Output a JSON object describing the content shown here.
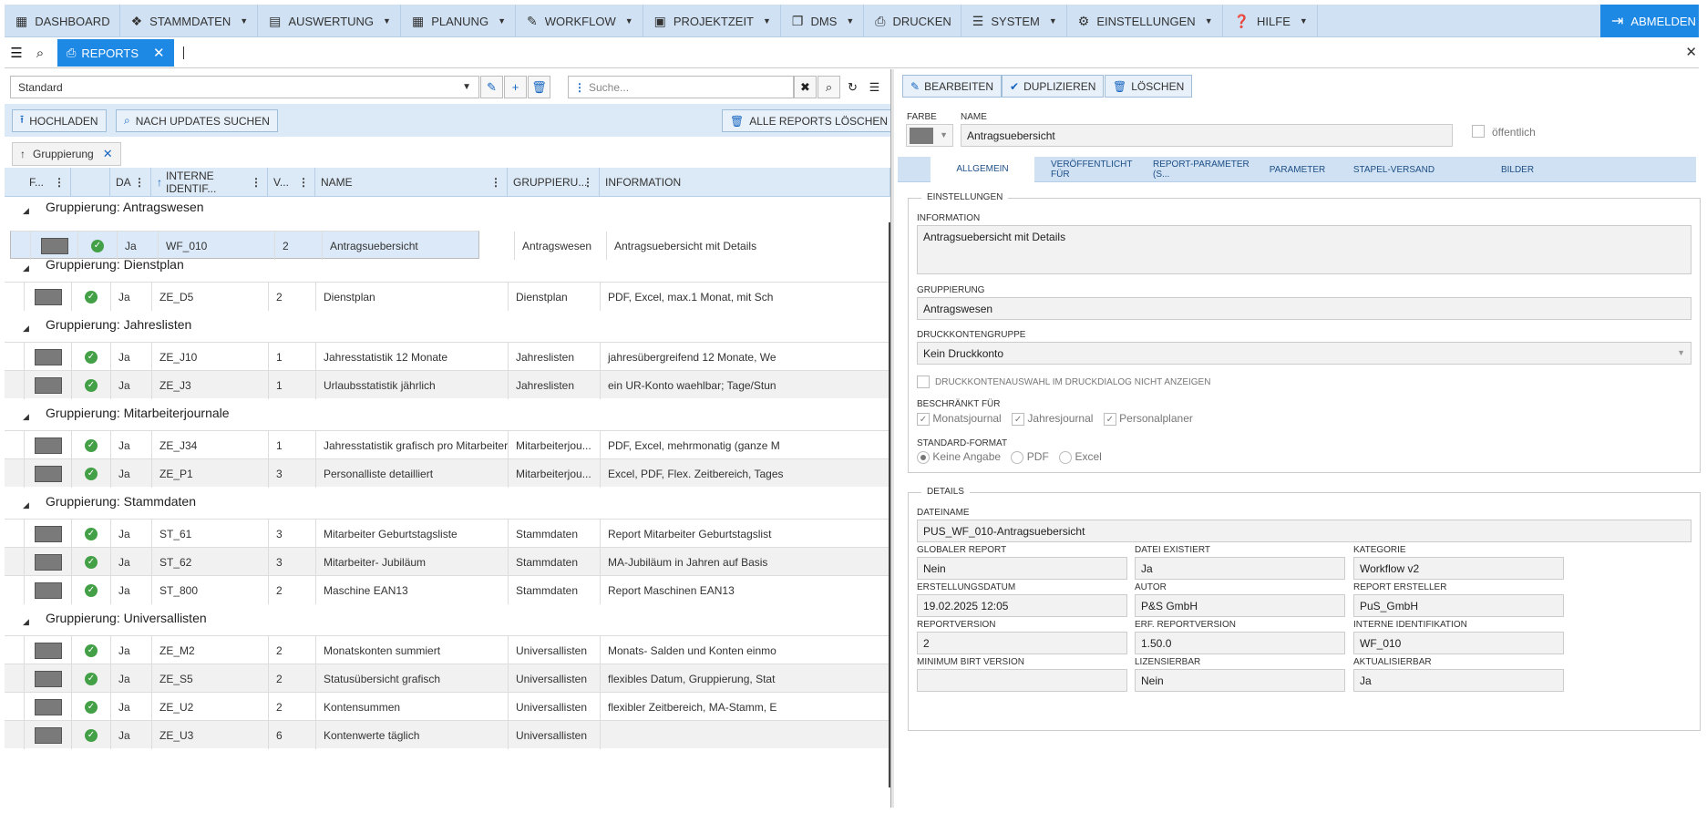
{
  "nav": {
    "items": [
      {
        "label": "DASHBOARD",
        "icon": "dashboard-icon",
        "caret": false
      },
      {
        "label": "STAMMDATEN",
        "icon": "cubes-icon",
        "caret": true
      },
      {
        "label": "AUSWERTUNG",
        "icon": "calendar-chart-icon",
        "caret": true
      },
      {
        "label": "PLANUNG",
        "icon": "calendar-icon",
        "caret": true
      },
      {
        "label": "WORKFLOW",
        "icon": "pencil-icon",
        "caret": true
      },
      {
        "label": "PROJEKTZEIT",
        "icon": "briefcase-icon",
        "caret": true
      },
      {
        "label": "DMS",
        "icon": "copy-icon",
        "caret": true
      },
      {
        "label": "DRUCKEN",
        "icon": "print-icon",
        "caret": false
      },
      {
        "label": "SYSTEM",
        "icon": "server-icon",
        "caret": true
      },
      {
        "label": "EINSTELLUNGEN",
        "icon": "gear-icon",
        "caret": true
      },
      {
        "label": "HILFE",
        "icon": "help-icon",
        "caret": true
      }
    ],
    "logout": "ABMELDEN"
  },
  "tabbar": {
    "tab": "REPORTS"
  },
  "left": {
    "select_value": "Standard",
    "search_placeholder": "Suche...",
    "upload": "HOCHLADEN",
    "updates": "NACH UPDATES SUCHEN",
    "delete_all": "ALLE REPORTS LÖSCHEN",
    "chip": "Gruppierung",
    "columns": [
      "F...",
      "DA",
      "INTERNE IDENTIF...",
      "V...",
      "NAME",
      "GRUPPIERU...",
      "INFORMATION"
    ],
    "groups": [
      {
        "label": "Gruppierung: Antragswesen",
        "rows": [
          {
            "da": "Ja",
            "id": "WF_010",
            "v": "2",
            "name": "Antragsuebersicht",
            "grp": "Antragswesen",
            "info": "Antragsuebersicht mit Details",
            "selected": true
          }
        ]
      },
      {
        "label": "Gruppierung: Dienstplan",
        "rows": [
          {
            "da": "Ja",
            "id": "ZE_D5",
            "v": "2",
            "name": "Dienstplan",
            "grp": "Dienstplan",
            "info": "PDF, Excel, max.1 Monat, mit Sch"
          }
        ]
      },
      {
        "label": "Gruppierung: Jahreslisten",
        "rows": [
          {
            "da": "Ja",
            "id": "ZE_J10",
            "v": "1",
            "name": "Jahresstatistik 12 Monate",
            "grp": "Jahreslisten",
            "info": "jahresübergreifend 12 Monate, We"
          },
          {
            "da": "Ja",
            "id": "ZE_J3",
            "v": "1",
            "name": "Urlaubsstatistik jährlich",
            "grp": "Jahreslisten",
            "info": "ein UR-Konto waehlbar; Tage/Stun"
          }
        ]
      },
      {
        "label": "Gruppierung: Mitarbeiterjournale",
        "rows": [
          {
            "da": "Ja",
            "id": "ZE_J34",
            "v": "1",
            "name": "Jahresstatistik grafisch pro Mitarbeiter",
            "grp": "Mitarbeiterjou...",
            "info": "PDF, Excel, mehrmonatig (ganze M"
          },
          {
            "da": "Ja",
            "id": "ZE_P1",
            "v": "3",
            "name": "Personalliste detailliert",
            "grp": "Mitarbeiterjou...",
            "info": "Excel, PDF, Flex. Zeitbereich, Tages"
          }
        ]
      },
      {
        "label": "Gruppierung: Stammdaten",
        "rows": [
          {
            "da": "Ja",
            "id": "ST_61",
            "v": "3",
            "name": "Mitarbeiter Geburtstagsliste",
            "grp": "Stammdaten",
            "info": "Report Mitarbeiter Geburtstagslist"
          },
          {
            "da": "Ja",
            "id": "ST_62",
            "v": "3",
            "name": "Mitarbeiter- Jubiläum",
            "grp": "Stammdaten",
            "info": "MA-Jubiläum in Jahren auf Basis"
          },
          {
            "da": "Ja",
            "id": "ST_800",
            "v": "2",
            "name": "Maschine EAN13",
            "grp": "Stammdaten",
            "info": "Report Maschinen EAN13"
          }
        ]
      },
      {
        "label": "Gruppierung: Universallisten",
        "rows": [
          {
            "da": "Ja",
            "id": "ZE_M2",
            "v": "2",
            "name": "Monatskonten summiert",
            "grp": "Universallisten",
            "info": "Monats- Salden und Konten einmo"
          },
          {
            "da": "Ja",
            "id": "ZE_S5",
            "v": "2",
            "name": "Statusübersicht grafisch",
            "grp": "Universallisten",
            "info": "flexibles Datum, Gruppierung, Stat"
          },
          {
            "da": "Ja",
            "id": "ZE_U2",
            "v": "2",
            "name": "Kontensummen",
            "grp": "Universallisten",
            "info": "flexibler Zeitbereich, MA-Stamm, E"
          },
          {
            "da": "Ja",
            "id": "ZE_U3",
            "v": "6",
            "name": "Kontenwerte täglich",
            "grp": "Universallisten",
            "info": ""
          }
        ]
      }
    ]
  },
  "right": {
    "edit": "BEARBEITEN",
    "duplicate": "DUPLIZIEREN",
    "delete": "LÖSCHEN",
    "farbe_label": "FARBE",
    "name_label": "NAME",
    "name_value": "Antragsuebersicht",
    "public_label": "öffentlich",
    "tabs": [
      "ALLGEMEIN",
      "VERÖFFENTLICHT FÜR",
      "REPORT-PARAMETER (S...",
      "PARAMETER",
      "STAPEL-VERSAND",
      "BILDER"
    ],
    "settings_legend": "EINSTELLUNGEN",
    "info_label": "INFORMATION",
    "info_value": "Antragsuebersicht mit Details",
    "grp_label": "GRUPPIERUNG",
    "grp_value": "Antragswesen",
    "dk_label": "DRUCKKONTENGRUPPE",
    "dk_value": "Kein Druckkonto",
    "dk_hide": "DRUCKKONTENAUSWAHL IM DRUCKDIALOG NICHT ANZEIGEN",
    "restrict_label": "BESCHRÄNKT FÜR",
    "restrict": [
      "Monatsjournal",
      "Jahresjournal",
      "Personalplaner"
    ],
    "format_label": "STANDARD-FORMAT",
    "formats": [
      "Keine Angabe",
      "PDF",
      "Excel"
    ],
    "details_legend": "DETAILS",
    "file_label": "DATEINAME",
    "file_value": "PUS_WF_010-Antragsuebersicht",
    "details": [
      {
        "label": "GLOBALER REPORT",
        "value": "Nein"
      },
      {
        "label": "DATEI EXISTIERT",
        "value": "Ja"
      },
      {
        "label": "KATEGORIE",
        "value": "Workflow v2"
      },
      {
        "label": "ERSTELLUNGSDATUM",
        "value": "19.02.2025 12:05"
      },
      {
        "label": "AUTOR",
        "value": "P&S GmbH"
      },
      {
        "label": "REPORT ERSTELLER",
        "value": "PuS_GmbH"
      },
      {
        "label": "REPORTVERSION",
        "value": "2"
      },
      {
        "label": "ERF. REPORTVERSION",
        "value": "1.50.0"
      },
      {
        "label": "INTERNE IDENTIFIKATION",
        "value": "WF_010"
      },
      {
        "label": "MINIMUM BIRT VERSION",
        "value": ""
      },
      {
        "label": "LIZENSIERBAR",
        "value": "Nein"
      },
      {
        "label": "AKTUALISIERBAR",
        "value": "Ja"
      }
    ]
  }
}
